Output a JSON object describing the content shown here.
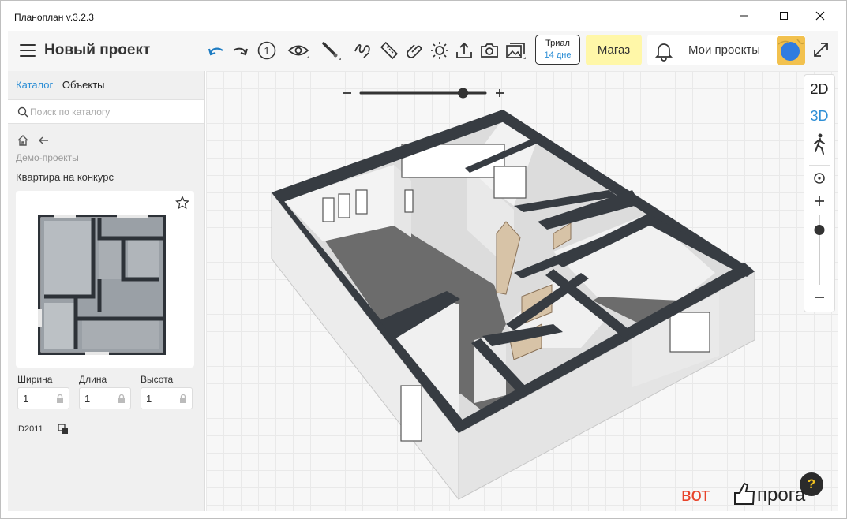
{
  "window": {
    "title": "Планоплан v.3.2.3"
  },
  "header": {
    "project_title": "Новый проект",
    "trial_label": "Триал",
    "trial_days": "14 дне",
    "store_label": "Магаз",
    "my_projects_label": "Мои проекты"
  },
  "toolbar": {
    "icons": [
      "undo-icon",
      "redo-icon",
      "level-icon",
      "eye-icon",
      "brush-icon",
      "wire-icon",
      "ruler-icon",
      "paperclip-icon",
      "sun-icon",
      "upload-icon",
      "camera-icon",
      "gallery-icon"
    ],
    "level_number": "1"
  },
  "sidebar": {
    "tab_catalog": "Каталог",
    "tab_objects": "Объекты",
    "search_placeholder": "Поиск по каталогу",
    "breadcrumb": "Демо-проекты",
    "item_title": "Квартира на конкурс",
    "width_label": "Ширина",
    "length_label": "Длина",
    "height_label": "Высота",
    "width_value": "1",
    "length_value": "1",
    "height_value": "1",
    "item_id": "ID2011"
  },
  "viewport": {
    "zoom_minus": "−",
    "zoom_plus": "+",
    "zoom_level": 0.82
  },
  "view_controls": {
    "mode_2d": "2D",
    "mode_3d": "3D",
    "zoom_plus": "+",
    "zoom_minus": "−",
    "zoom_level": 0.79
  },
  "help_label": "?",
  "watermark": {
    "left": "вот",
    "right": "прога"
  },
  "colors": {
    "accent": "#2e8fd6",
    "store_bg": "#fff7a8",
    "wall": "#3b3f45",
    "floor": "#6b6b6b"
  }
}
